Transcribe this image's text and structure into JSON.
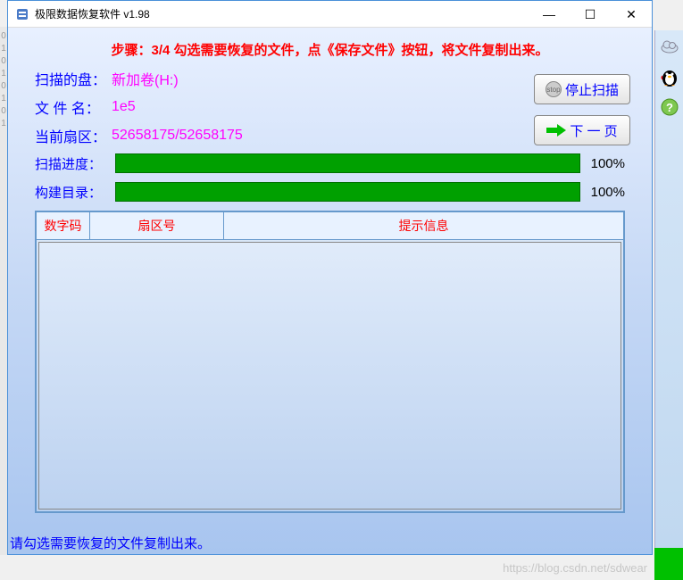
{
  "window": {
    "title": "极限数据恢复软件 v1.98",
    "minimize": "—",
    "maximize": "☐",
    "close": "✕"
  },
  "step_banner": "步骤：3/4 勾选需要恢复的文件，点《保存文件》按钮，将文件复制出来。",
  "info": {
    "disk_label": "扫描的盘：",
    "disk_value": "新加卷(H:)",
    "filename_label": "文 件 名：",
    "filename_value": "1e5",
    "sector_label": "当前扇区：",
    "sector_value": "52658175/52658175"
  },
  "progress": {
    "scan_label": "扫描进度：",
    "scan_pct": "100%",
    "build_label": "构建目录：",
    "build_pct": "100%"
  },
  "table": {
    "col1": "数字码",
    "col2": "扇区号",
    "col3": "提示信息"
  },
  "buttons": {
    "stop": "停止扫描",
    "next": "下 一 页"
  },
  "footer": "请勾选需要恢复的文件复制出来。",
  "watermark": "https://blog.csdn.net/sdwear"
}
